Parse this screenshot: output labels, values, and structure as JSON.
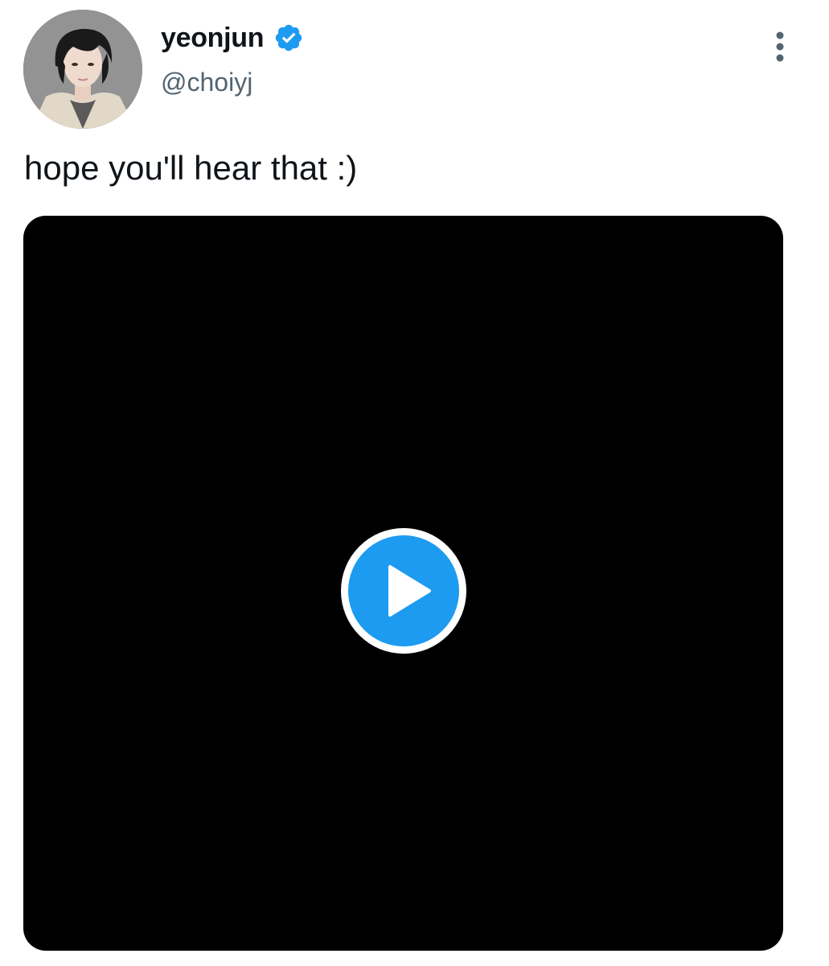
{
  "author": {
    "display_name": "yeonjun",
    "handle": "@choiyj",
    "verified": true
  },
  "tweet": {
    "text": "hope you'll hear that :)"
  },
  "media": {
    "type": "video",
    "play_icon": "play-icon"
  },
  "icons": {
    "verified": "verified-badge-icon",
    "more": "more-options-icon"
  },
  "colors": {
    "accent": "#1d9bf0",
    "text_primary": "#0f1419",
    "text_secondary": "#536471",
    "media_background": "#000000",
    "play_button": "#1d9bf0"
  }
}
